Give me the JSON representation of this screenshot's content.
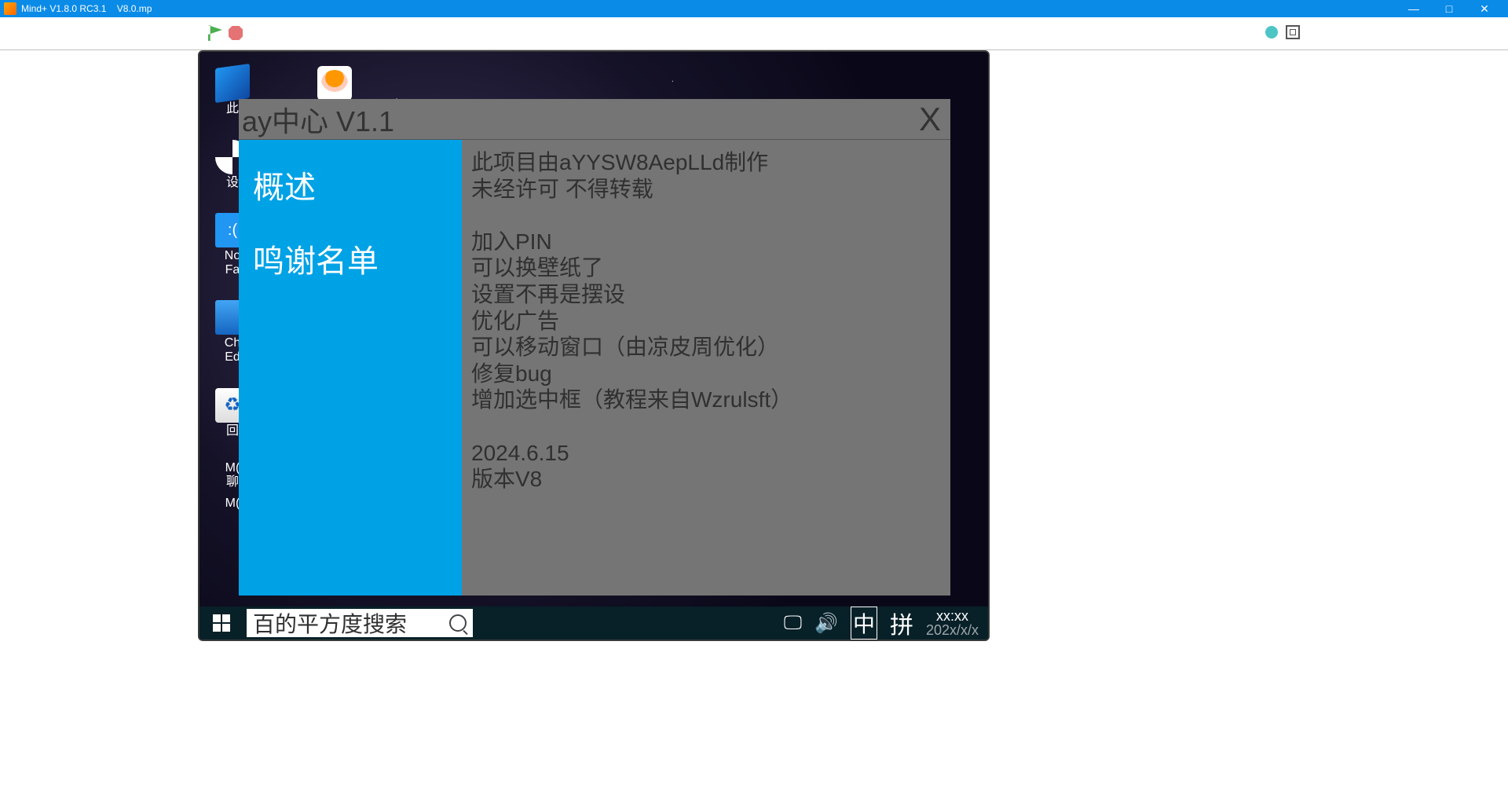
{
  "titlebar": {
    "app_name": "Mind+ V1.8.0 RC3.1",
    "file_name": "V8.0.mp"
  },
  "stage": {
    "desktop_icons": {
      "this_pc": "此",
      "settings": "设",
      "notes_fa": "No\nFa",
      "chrome_ed": "Ch\nEd",
      "recycle": "回",
      "mc_chat": "M(\n聊",
      "mc2": "M("
    }
  },
  "dialog": {
    "title": "ay中心 V1.1",
    "close": "X",
    "tabs": {
      "overview": "概述",
      "credits": "鸣谢名单"
    },
    "content": "此项目由aYYSW8AepLLd制作\n未经许可 不得转载\n\n加入PIN\n可以换壁纸了\n设置不再是摆设\n优化广告\n可以移动窗口（由凉皮周优化）\n修复bug\n增加选中框（教程来自Wzrulsft）\n\n2024.6.15\n版本V8"
  },
  "sim_taskbar": {
    "search": "百的平方度搜索",
    "ime1": "中",
    "ime2": "拼",
    "time": "xx:xx",
    "date": "202x/x/x"
  }
}
